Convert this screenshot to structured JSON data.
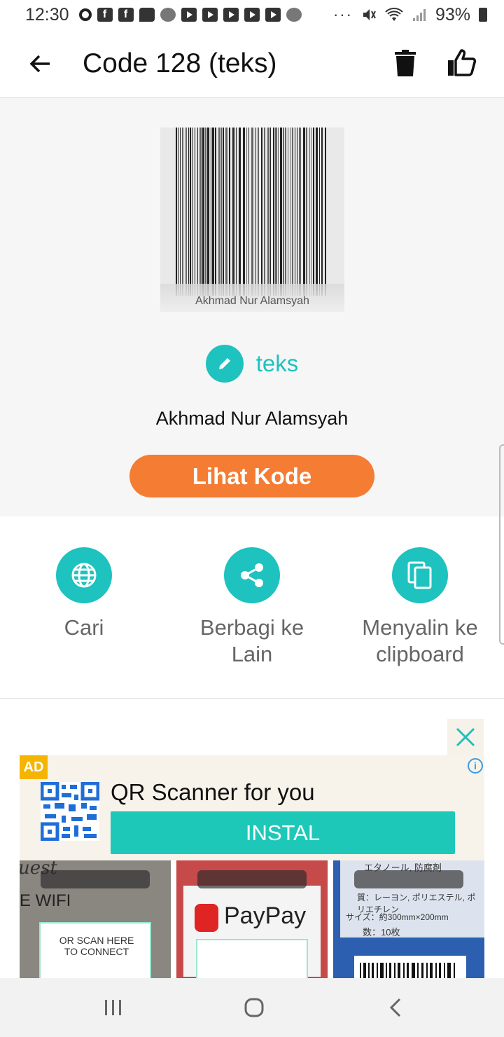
{
  "status_bar": {
    "time": "12:30",
    "battery": "93%",
    "more": "···"
  },
  "app_bar": {
    "title": "Code 128 (teks)"
  },
  "result": {
    "barcode_caption": "Akhmad Nur Alamsyah",
    "type_label": "teks",
    "content": "Akhmad Nur Alamsyah",
    "view_button": "Lihat Kode"
  },
  "actions": [
    {
      "label": "Cari",
      "icon": "globe-icon"
    },
    {
      "label": "Berbagi ke Lain",
      "icon": "share-icon"
    },
    {
      "label": "Menyalin ke clipboard",
      "icon": "copy-icon"
    }
  ],
  "ad": {
    "badge": "AD",
    "info": "i",
    "title": "QR Scanner for you",
    "install": "INSTAL",
    "shots": [
      {
        "big": "E WIFI",
        "small": "OR SCAN HERE TO CONNECT",
        "corner": "uest"
      },
      {
        "big": "PayPay"
      },
      {
        "small": "エタノール, 防腐剤",
        "small2": "質：レーヨン, ポリエステル, ポリエチレン",
        "small3": "サイズ：約300mm×200mm",
        "small4": "数：10枚"
      }
    ]
  },
  "colors": {
    "accent": "#1ec2be",
    "button_orange": "#f47c33",
    "ad_badge": "#f5b400"
  }
}
